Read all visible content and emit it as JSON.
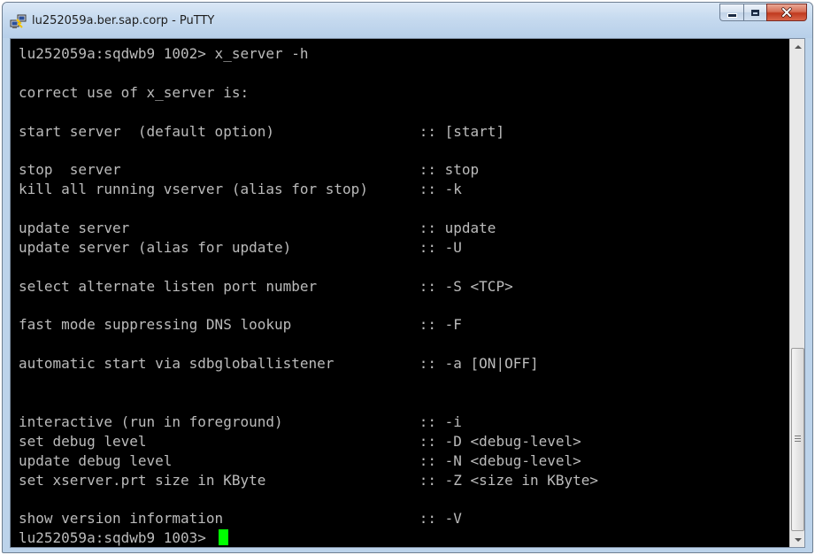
{
  "window": {
    "title": "lu252059a.ber.sap.corp - PuTTY",
    "icon": "putty-computers-icon",
    "buttons": {
      "minimize": "minimize-icon",
      "maximize": "maximize-icon",
      "close": "close-icon"
    }
  },
  "terminal": {
    "foreground": "#bbbbbb",
    "background": "#000000",
    "cursor_color": "#00ff00",
    "lines": [
      "lu252059a:sqdwb9 1002> x_server -h",
      "",
      "correct use of x_server is:",
      "",
      "start server  (default option)                 :: [start]",
      "",
      "stop  server                                   :: stop",
      "kill all running vserver (alias for stop)      :: -k",
      "",
      "update server                                  :: update",
      "update server (alias for update)               :: -U",
      "",
      "select alternate listen port number            :: -S <TCP>",
      "",
      "fast mode suppressing DNS lookup               :: -F",
      "",
      "automatic start via sdbgloballistener          :: -a [ON|OFF]",
      "",
      "",
      "interactive (run in foreground)                :: -i",
      "set debug level                                :: -D <debug-level>",
      "update debug level                             :: -N <debug-level>",
      "set xserver.prt size in KByte                  :: -Z <size in KByte>",
      "",
      "show version information                       :: -V"
    ],
    "prompt": "lu252059a:sqdwb9 1003> "
  },
  "scrollbar": {
    "up_icon": "scroll-up-arrow-icon",
    "down_icon": "scroll-down-arrow-icon",
    "position_fraction": 1.0,
    "visible_fraction": 0.36
  }
}
